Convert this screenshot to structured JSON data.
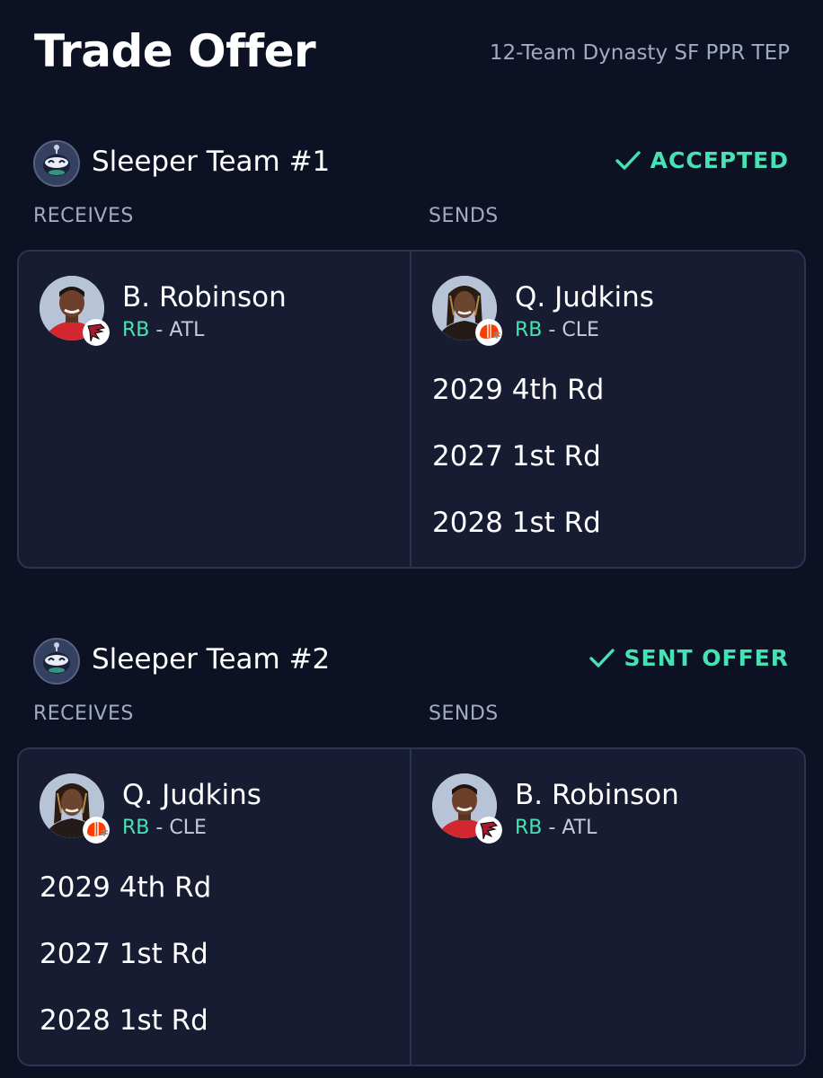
{
  "header": {
    "title": "Trade Offer",
    "league": "12-Team Dynasty SF PPR TEP"
  },
  "colors": {
    "background": "#0d1124",
    "panel": "#171c33",
    "border": "#2b3550",
    "accent": "#47e2b4",
    "muted": "#a2abc4"
  },
  "teams": [
    {
      "name": "Sleeper Team #1",
      "status": "ACCEPTED",
      "receives_label": "RECEIVES",
      "sends_label": "SENDS",
      "receives": {
        "player": {
          "name": "B. Robinson",
          "position": "RB",
          "separator": " - ",
          "team": "ATL",
          "logo": "falcons-logo-icon"
        },
        "picks": []
      },
      "sends": {
        "player": {
          "name": "Q. Judkins",
          "position": "RB",
          "separator": " - ",
          "team": "CLE",
          "logo": "browns-helmet-icon"
        },
        "picks": [
          "2029 4th Rd",
          "2027 1st Rd",
          "2028 1st Rd"
        ]
      }
    },
    {
      "name": "Sleeper Team #2",
      "status": "SENT OFFER",
      "receives_label": "RECEIVES",
      "sends_label": "SENDS",
      "receives": {
        "player": {
          "name": "Q. Judkins",
          "position": "RB",
          "separator": " - ",
          "team": "CLE",
          "logo": "browns-helmet-icon"
        },
        "picks": [
          "2029 4th Rd",
          "2027 1st Rd",
          "2028 1st Rd"
        ]
      },
      "sends": {
        "player": {
          "name": "B. Robinson",
          "position": "RB",
          "separator": " - ",
          "team": "ATL",
          "logo": "falcons-logo-icon"
        },
        "picks": []
      }
    }
  ]
}
